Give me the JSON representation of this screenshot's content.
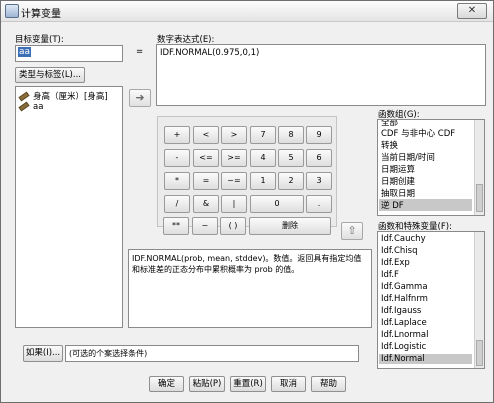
{
  "window": {
    "title": "计算变量",
    "close_glyph": "✕"
  },
  "target": {
    "label": "目标变量(T):",
    "value": "aa",
    "type_button": "类型与标签(L)..."
  },
  "equals": "=",
  "expression": {
    "label": "数字表达式(E):",
    "value": "IDF.NORMAL(0.975,0,1)"
  },
  "variables": [
    {
      "label": "身高（厘米）[身高]"
    },
    {
      "label": "aa"
    }
  ],
  "keypad": [
    [
      "+",
      "<",
      ">",
      "7",
      "8",
      "9"
    ],
    [
      "-",
      "<=",
      ">=",
      "4",
      "5",
      "6"
    ],
    [
      "*",
      "=",
      "~=",
      "1",
      "2",
      "3"
    ],
    [
      "/",
      "&",
      "|",
      "0",
      "."
    ],
    [
      "**",
      "~",
      "( )",
      "删除"
    ]
  ],
  "description": "IDF.NORMAL(prob, mean, stddev)。数值。返回具有指定均值和标准差的正态分布中累积概率为 prob 的值。",
  "function_group": {
    "label": "函数组(G):",
    "items": [
      "CDF 与非中心 CDF",
      "转换",
      "当前日期/时间",
      "日期运算",
      "日期创建",
      "抽取日期",
      "逆 DF"
    ],
    "selected": "逆 DF",
    "partial_top": "全部"
  },
  "functions": {
    "label": "函数和特殊变量(F):",
    "items": [
      "Idf.Cauchy",
      "Idf.Chisq",
      "Idf.Exp",
      "Idf.F",
      "Idf.Gamma",
      "Idf.Halfnrm",
      "Idf.Igauss",
      "Idf.Laplace",
      "Idf.Lnormal",
      "Idf.Logistic",
      "Idf.Normal"
    ],
    "selected": "Idf.Normal"
  },
  "if_button": {
    "label": "如果(I)...",
    "condition": "(可选的个案选择条件)"
  },
  "bottom_buttons": [
    "确定",
    "粘贴(P)",
    "重置(R)",
    "取消",
    "帮助"
  ]
}
